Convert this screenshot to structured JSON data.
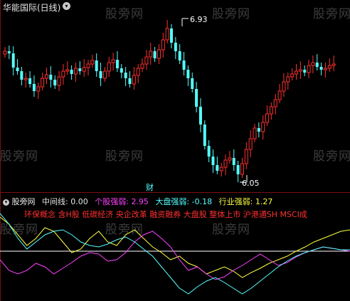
{
  "title_bar": {
    "title": "华能国际(日线)"
  },
  "main_chart": {
    "high_label": "6.93",
    "low_label": "6.05",
    "marker": "财"
  },
  "indicator_header": {
    "name": "股旁网",
    "mid_label": "中间线:",
    "mid_value": "0.00",
    "stock_label": "个股强弱:",
    "stock_value": "2.95",
    "market_label": "大盘强弱:",
    "market_value": "-0.18",
    "industry_label": "行业强弱:",
    "industry_value": "1.27"
  },
  "concept_tags": "环保概念 含H股 低碳经济 央企改革 融资融券 大盘股 整体上市 沪港通SH MSCI成",
  "watermarks": [
    "股旁网",
    "股旁网",
    "股旁网",
    "股旁网",
    "股旁网",
    "股旁网",
    "股旁网",
    "股旁网",
    "股旁网"
  ],
  "colors": {
    "up": "#ff3030",
    "down": "#54ffff",
    "white_line": "#ffffff",
    "magenta": "#ff40ff",
    "yellow": "#ffff40",
    "cyan": "#54ffff",
    "frame": "#7a1010"
  }
}
